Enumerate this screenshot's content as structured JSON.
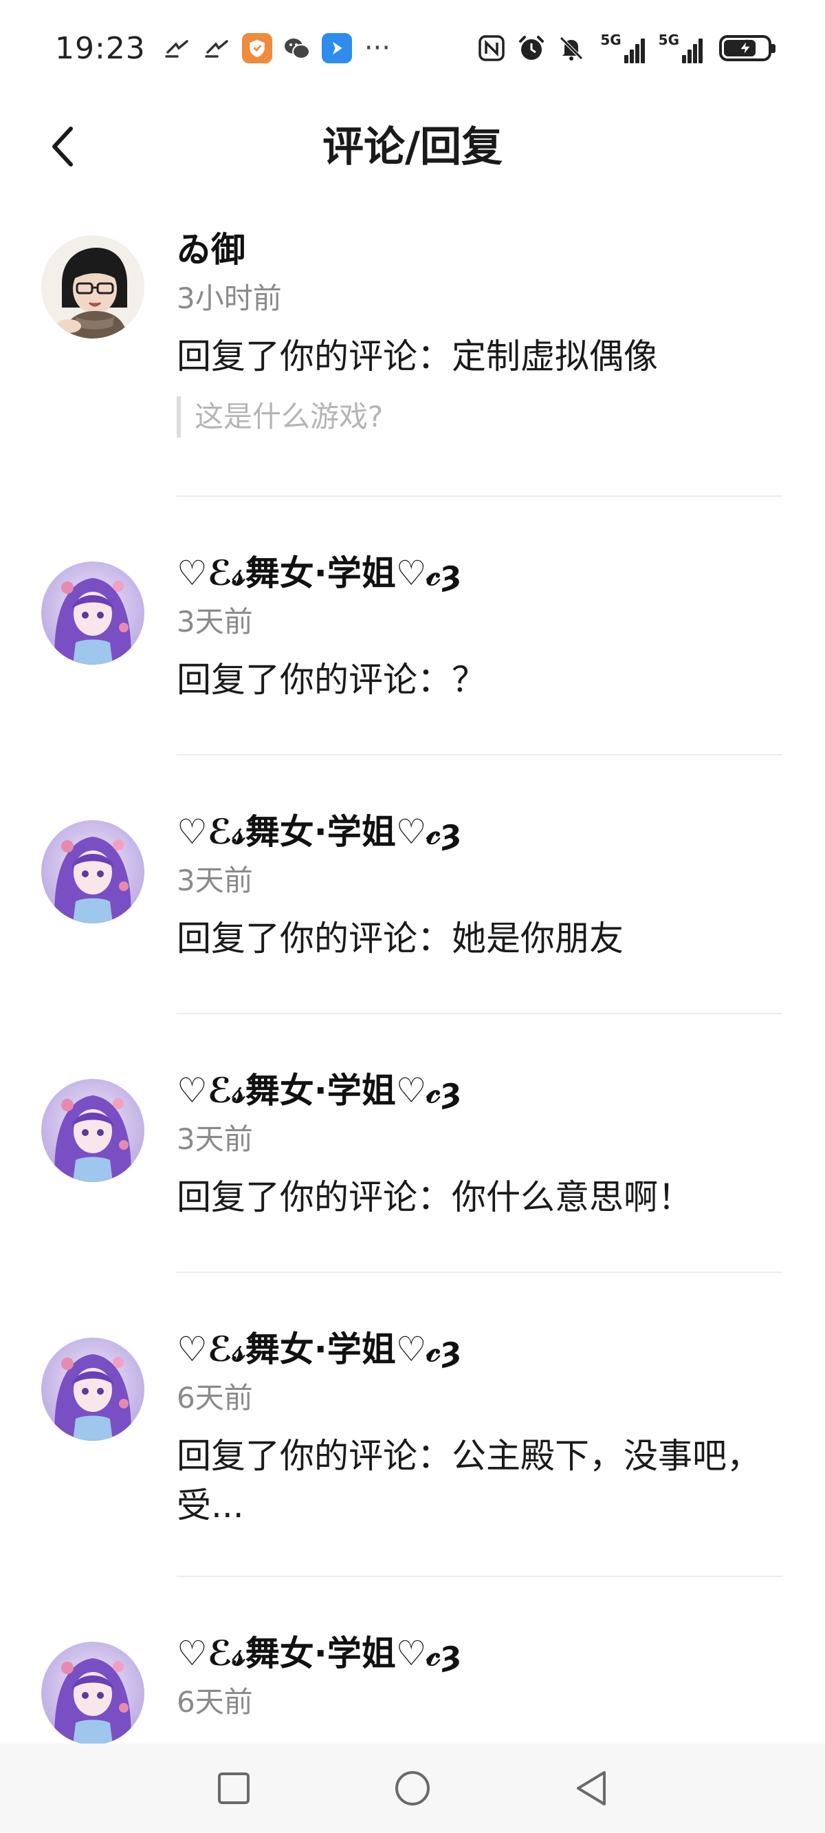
{
  "status_bar": {
    "time": "19:23",
    "more": "···",
    "network_tag_1": "5G",
    "network_tag_2": "5G",
    "icons": [
      "missed-call-icon",
      "missed-call-icon",
      "shield-app-icon",
      "wechat-icon",
      "arrow-app-icon",
      "nfc-icon",
      "alarm-icon",
      "mute-icon",
      "signal-5g-icon",
      "signal-5g-icon",
      "battery-charging-icon"
    ]
  },
  "header": {
    "title": "评论/回复",
    "back_icon": "chevron-left-icon"
  },
  "items": [
    {
      "username": "ゐ御",
      "time": "3小时前",
      "text": "回复了你的评论：定制虚拟偶像",
      "quote": "这是什么游戏?"
    },
    {
      "username": "♡ℰ𝓈舞女·学姐♡𝒸ȝ",
      "time": "3天前",
      "text": "回复了你的评论：？"
    },
    {
      "username": "♡ℰ𝓈舞女·学姐♡𝒸ȝ",
      "time": "3天前",
      "text": "回复了你的评论：她是你朋友"
    },
    {
      "username": "♡ℰ𝓈舞女·学姐♡𝒸ȝ",
      "time": "3天前",
      "text": "回复了你的评论：你什么意思啊！"
    },
    {
      "username": "♡ℰ𝓈舞女·学姐♡𝒸ȝ",
      "time": "6天前",
      "text": "回复了你的评论：公主殿下，没事吧，受..."
    },
    {
      "username": "♡ℰ𝓈舞女·学姐♡𝒸ȝ",
      "time": "6天前"
    }
  ],
  "nav_bar": {
    "icons": [
      "recents-square-icon",
      "home-circle-icon",
      "back-triangle-icon"
    ]
  },
  "colors": {
    "text_primary": "#1a1a1a",
    "text_secondary": "#8a8a8a",
    "quote_text": "#b5b5b5",
    "divider": "#ececec",
    "nav_bg": "#f7f7f7"
  }
}
